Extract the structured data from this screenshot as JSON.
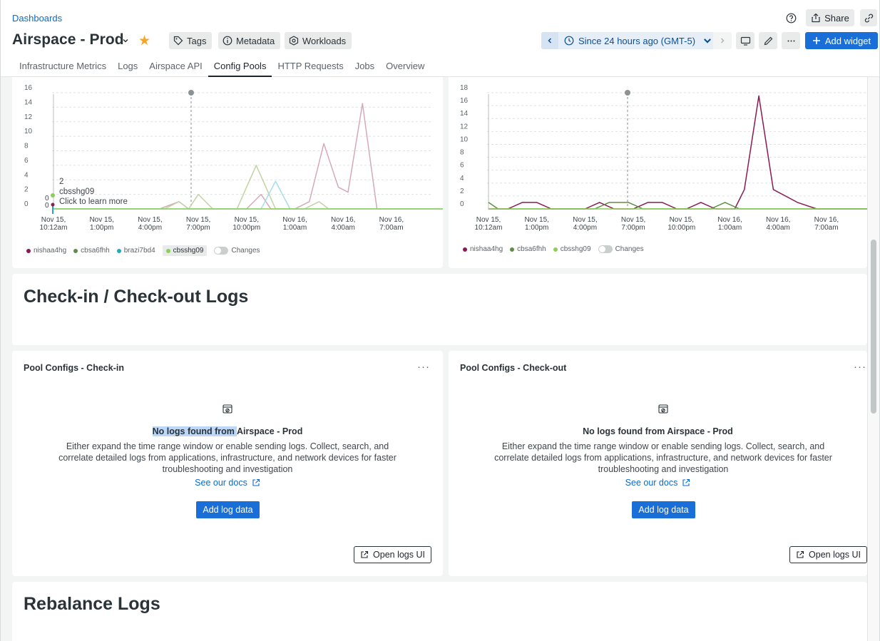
{
  "header": {
    "breadcrumb": "Dashboards",
    "title": "Airspace - Prod",
    "pills": [
      "Tags",
      "Metadata",
      "Workloads"
    ],
    "share_label": "Share",
    "time_range": "Since 24 hours ago (GMT-5)",
    "add_widget_label": "Add widget"
  },
  "tabs": [
    "Infrastructure Metrics",
    "Logs",
    "Airspace API",
    "Config Pools",
    "HTTP Requests",
    "Jobs",
    "Overview"
  ],
  "active_tab": "Config Pools",
  "chart_data": [
    {
      "type": "line",
      "title": "",
      "x": [
        "Nov 15, 10:12am",
        "Nov 15, 1:00pm",
        "Nov 15, 4:00pm",
        "Nov 15, 7:00pm",
        "Nov 15, 10:00pm",
        "Nov 16, 1:00am",
        "Nov 16, 4:00am",
        "Nov 16, 7:00am"
      ],
      "yticks": [
        0,
        2,
        4,
        6,
        8,
        10,
        12,
        14,
        16
      ],
      "ylim": [
        0,
        16
      ],
      "series": [
        {
          "name": "nishaa4hg",
          "color": "#d6a9b9",
          "points": [
            [
              0,
              0
            ],
            [
              2.2,
              0
            ],
            [
              2.6,
              1
            ],
            [
              2.8,
              0
            ],
            [
              4.0,
              0
            ],
            [
              4.3,
              2
            ],
            [
              4.5,
              0
            ],
            [
              5.0,
              0
            ],
            [
              5.3,
              1
            ],
            [
              5.6,
              9
            ],
            [
              5.9,
              3
            ],
            [
              6.1,
              2.3
            ],
            [
              6.4,
              14.5
            ],
            [
              6.7,
              0
            ],
            [
              8.5,
              0
            ]
          ]
        },
        {
          "name": "cbsa6fhh",
          "color": "#c0d3a3",
          "points": [
            [
              0,
              0
            ],
            [
              2.3,
              0
            ],
            [
              2.6,
              1
            ],
            [
              2.8,
              0
            ],
            [
              3.0,
              2
            ],
            [
              3.3,
              0
            ],
            [
              3.8,
              0
            ],
            [
              4.2,
              6
            ],
            [
              4.6,
              0
            ],
            [
              5.2,
              0
            ],
            [
              5.5,
              1
            ],
            [
              5.7,
              0
            ],
            [
              8.5,
              0
            ]
          ]
        },
        {
          "name": "brazi7bd4",
          "color": "#a6dceb",
          "points": [
            [
              0,
              0
            ],
            [
              4.3,
              0
            ],
            [
              4.6,
              3.8
            ],
            [
              4.9,
              0
            ],
            [
              8.5,
              0
            ]
          ]
        },
        {
          "name": "cbsshg09",
          "color": "#8ccf55",
          "points": [
            [
              0,
              0
            ],
            [
              8.5,
              0
            ]
          ]
        }
      ],
      "tooltip": {
        "value": "2",
        "series": "cbsshg09",
        "hint": "Click to learn more"
      },
      "marker_values": [
        "0",
        "0"
      ],
      "legend": [
        "nishaa4hg",
        "cbsa6fhh",
        "brazi7bd4",
        "cbsshg09"
      ],
      "changes_label": "Changes"
    },
    {
      "type": "line",
      "title": "",
      "x": [
        "Nov 15, 10:12am",
        "Nov 15, 1:00pm",
        "Nov 15, 4:00pm",
        "Nov 15, 7:00pm",
        "Nov 15, 10:00pm",
        "Nov 16, 1:00am",
        "Nov 16, 4:00am",
        "Nov 16, 7:00am"
      ],
      "yticks": [
        0,
        2,
        4,
        6,
        8,
        10,
        12,
        14,
        16,
        18
      ],
      "ylim": [
        0,
        18
      ],
      "series": [
        {
          "name": "nishaa4hg",
          "color": "#8a1a55",
          "points": [
            [
              0,
              0
            ],
            [
              0.4,
              0
            ],
            [
              0.7,
              1
            ],
            [
              1.0,
              1
            ],
            [
              1.3,
              0
            ],
            [
              2.0,
              0
            ],
            [
              2.3,
              1
            ],
            [
              2.6,
              0
            ],
            [
              3.0,
              0
            ],
            [
              3.3,
              1
            ],
            [
              3.6,
              1
            ],
            [
              3.9,
              0
            ],
            [
              4.1,
              0
            ],
            [
              4.4,
              1
            ],
            [
              4.7,
              0
            ],
            [
              5.1,
              0
            ],
            [
              5.3,
              3
            ],
            [
              5.6,
              17.5
            ],
            [
              5.9,
              3
            ],
            [
              6.4,
              1
            ],
            [
              6.8,
              0
            ],
            [
              8.1,
              0
            ],
            [
              8.4,
              1
            ],
            [
              8.7,
              1
            ],
            [
              8.9,
              0
            ]
          ]
        },
        {
          "name": "cbsa6fhh",
          "color": "#5f8d45",
          "points": [
            [
              0,
              1
            ],
            [
              0.2,
              0
            ],
            [
              2.2,
              0
            ],
            [
              2.5,
              1
            ],
            [
              2.9,
              1
            ],
            [
              3.2,
              0
            ],
            [
              4.6,
              0
            ],
            [
              4.9,
              1
            ],
            [
              5.2,
              0
            ],
            [
              8.3,
              0
            ],
            [
              8.6,
              1
            ],
            [
              8.9,
              0
            ]
          ]
        },
        {
          "name": "cbsshg09",
          "color": "#8ccf55",
          "points": [
            [
              0,
              0
            ],
            [
              8.9,
              0
            ]
          ]
        }
      ],
      "legend": [
        "nishaa4hg",
        "cbsa6fhh",
        "cbsshg09"
      ],
      "changes_label": "Changes"
    }
  ],
  "sections": {
    "checkin_heading": "Check-in / Check-out Logs",
    "rebalance_heading": "Rebalance Logs"
  },
  "panels": [
    {
      "title": "Pool Configs - Check-in",
      "nologs_highlight": "No logs found from ",
      "nologs_rest": "Airspace - Prod",
      "description": "Either expand the time range window or enable sending logs. Collect, search, and correlate detailed logs from applications, infrastructure, and network devices for faster troubleshooting and investigation",
      "docs_label": "See our docs",
      "add_label": "Add log data",
      "open_label": "Open logs UI"
    },
    {
      "title": "Pool Configs - Check-out",
      "nologs": "No logs found from Airspace - Prod",
      "description": "Either expand the time range window or enable sending logs. Collect, search, and correlate detailed logs from applications, infrastructure, and network devices for faster troubleshooting and investigation",
      "docs_label": "See our docs",
      "add_label": "Add log data",
      "open_label": "Open logs UI"
    }
  ],
  "legend_colors": {
    "nishaa4hg": "#8a1a55",
    "cbsa6fhh": "#5f8d45",
    "brazi7bd4": "#22a8c4",
    "cbsshg09": "#8ccf55"
  },
  "accent": "#1a6ed8"
}
